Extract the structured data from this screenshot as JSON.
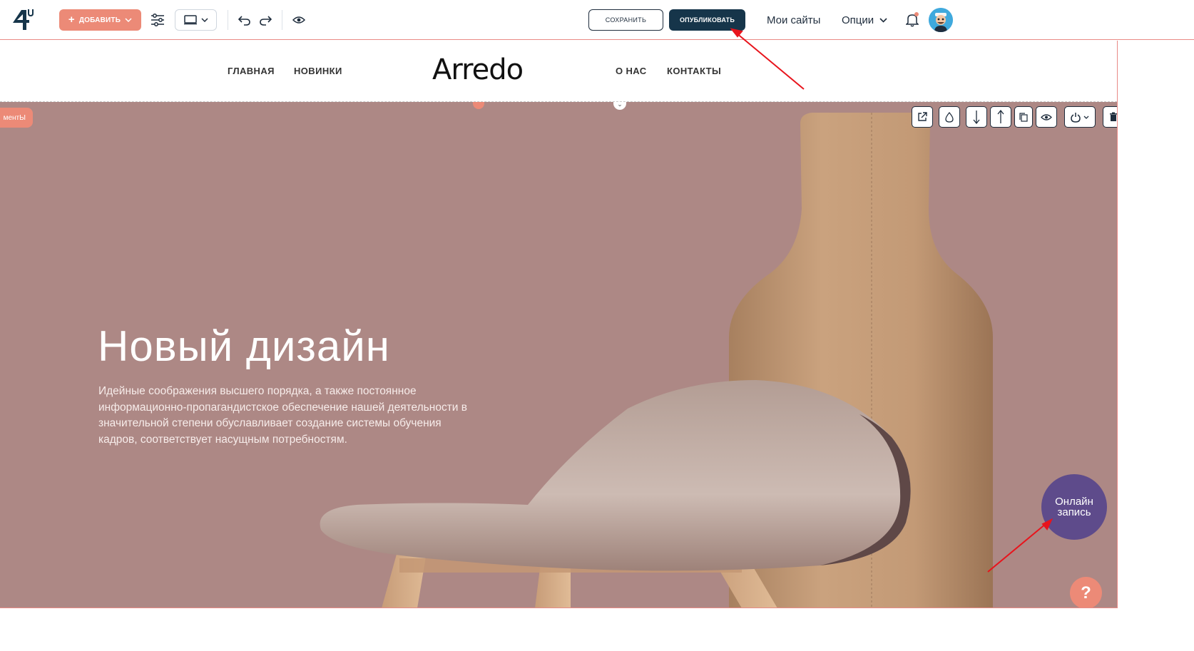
{
  "toolbar": {
    "add_label": "ДОБАВИТЬ",
    "save_label": "СОХРАНИТЬ",
    "publish_label": "ОПУБЛИКОВАТЬ",
    "my_sites_label": "Мои сайты",
    "options_label": "Опции",
    "icons": [
      "logo-4u",
      "plus",
      "settings-sliders",
      "desktop-device",
      "chevron-down",
      "undo",
      "redo",
      "preview-eye",
      "bell",
      "user-avatar"
    ]
  },
  "site": {
    "brand": "Arredo",
    "nav_left": [
      "ГЛАВНАЯ",
      "НОВИНКИ"
    ],
    "nav_right": [
      "О НАС",
      "КОНТАКТЫ"
    ]
  },
  "hero": {
    "elements_tab": "ментЫ",
    "title": "Новый дизайн",
    "text": "Идейные соображения высшего порядка, а также постоянное информационно-пропагандистское обеспечение нашей деятельности в значительной степени обуславливает создание системы обучения кадров, соответствует насущным потребностям.",
    "online_line1": "Онлайн",
    "online_line2": "запись",
    "help": "?",
    "tool_icons": [
      "external-link",
      "color-drop",
      "move-down",
      "move-up",
      "duplicate",
      "visibility-eye",
      "power",
      "delete-trash"
    ]
  },
  "colors": {
    "accent": "#ec8a77",
    "publish": "#16354a",
    "hero_bg": "#ad8885",
    "online_button": "#5e4b8b",
    "annotation_arrow": "#e8141c"
  }
}
